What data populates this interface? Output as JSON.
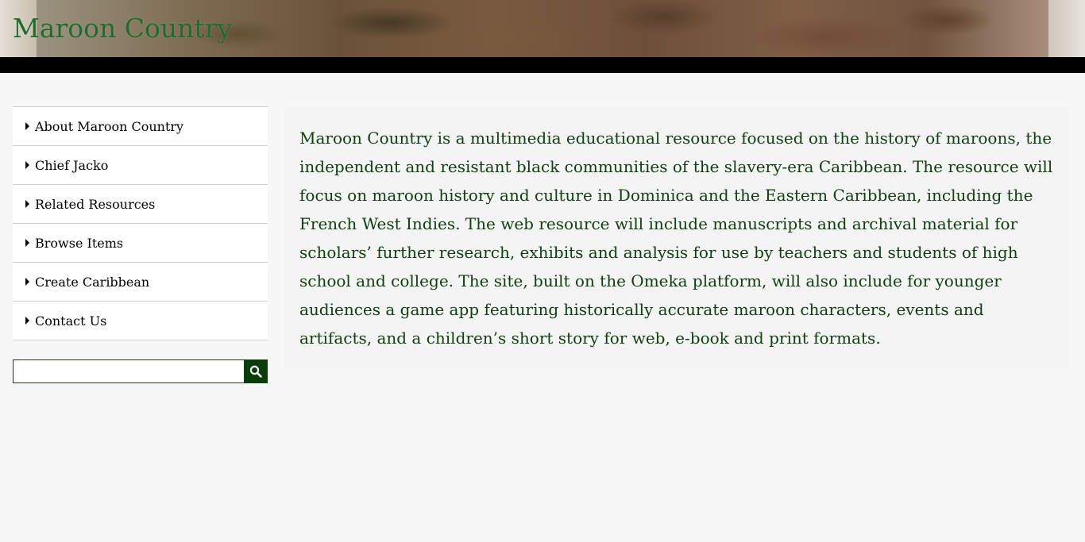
{
  "header": {
    "site_title": "Maroon Country"
  },
  "sidebar": {
    "items": [
      {
        "label": "About Maroon Country"
      },
      {
        "label": "Chief Jacko"
      },
      {
        "label": "Related Resources"
      },
      {
        "label": "Browse Items"
      },
      {
        "label": "Create Caribbean"
      },
      {
        "label": "Contact Us"
      }
    ]
  },
  "search": {
    "value": "",
    "button_icon": "search-icon"
  },
  "main": {
    "intro": "Maroon Country is a multimedia educational resource focused on the history of maroons, the independent and resistant black communities of the slavery-era Caribbean. The resource will focus on maroon history and culture in Dominica and the Eastern Caribbean, including the French West Indies. The web resource will include manuscripts and archival material for scholars’ further research, exhibits and analysis for use by teachers and students of high school and college. The site, built on the Omeka platform, will also include for younger audiences a game app featuring historically accurate maroon characters, events and artifacts, and a children’s short story for web, e-book and print formats."
  },
  "colors": {
    "title_green": "#1f6b2e",
    "text_green": "#0f3e10",
    "search_button": "#0b3d0b",
    "bar": "#000000"
  }
}
